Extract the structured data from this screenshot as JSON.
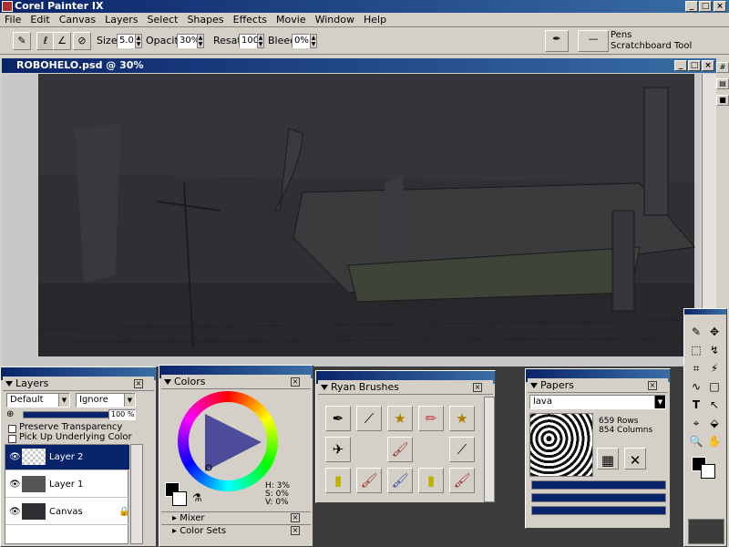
{
  "app": {
    "title": "Corel Painter IX"
  },
  "menu": [
    "File",
    "Edit",
    "Canvas",
    "Layers",
    "Select",
    "Shapes",
    "Effects",
    "Movie",
    "Window",
    "Help"
  ],
  "property_bar": {
    "size_label": "Size:",
    "size_value": "5.0",
    "opacity_label": "Opacity:",
    "opacity_value": "30%",
    "resat_label": "Resat:",
    "resat_value": "100",
    "bleed_label": "Bleed:",
    "bleed_value": "0%",
    "brush_category": "Pens",
    "brush_variant": "Scratchboard Tool"
  },
  "document": {
    "title": "ROBOHELO.psd @ 30%"
  },
  "layers_panel": {
    "title": "Layers",
    "composite_method": "Default",
    "depth": "Ignore",
    "opacity": "100 %",
    "preserve_transparency": "Preserve Transparency",
    "pick_up_underlying": "Pick Up Underlying Color",
    "layers": [
      {
        "name": "Layer 2",
        "selected": true
      },
      {
        "name": "Layer 1",
        "selected": false
      },
      {
        "name": "Canvas",
        "selected": false
      }
    ]
  },
  "colors_panel": {
    "title": "Colors",
    "h": "H: 3%",
    "s": "S: 0%",
    "v": "V: 0%"
  },
  "mixer_title": "Mixer",
  "color_sets_title": "Color Sets",
  "brushes_panel": {
    "title": "Ryan Brushes"
  },
  "papers_panel": {
    "title": "Papers",
    "selected": "lava",
    "rows": "659 Rows",
    "columns": "854 Columns"
  },
  "colors": {
    "titlebar_start": "#0a246a",
    "titlebar_end": "#3a6ea5",
    "chrome": "#d4d0c8",
    "selected_layer": "#0a246a",
    "canvas_dark": "#2f2f34"
  }
}
